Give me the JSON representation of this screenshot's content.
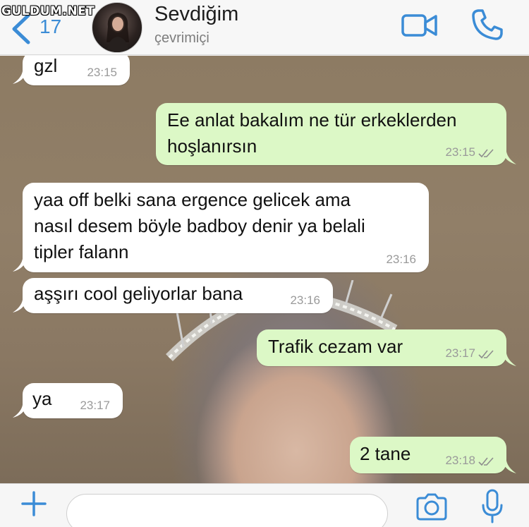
{
  "watermark": "GULDUM.NET",
  "header": {
    "back_count": "17",
    "contact_name": "Sevdiğim",
    "status": "çevrimiçi",
    "icons": {
      "back": "chevron-left-icon",
      "video": "video-camera-icon",
      "call": "phone-icon"
    },
    "accent": "#3b8cd6"
  },
  "messages": [
    {
      "dir": "in",
      "text": "gzl",
      "time": "23:15"
    },
    {
      "dir": "out",
      "text": "Ee anlat bakalım ne tür erkeklerden\nhoşlanırsın",
      "time": "23:15",
      "read": true
    },
    {
      "dir": "in",
      "text": "yaa off belki sana ergence gelicek ama\nnasıl desem böyle badboy denir ya belali\ntipler falann",
      "time": "23:16"
    },
    {
      "dir": "in",
      "text": "aşşırı cool geliyorlar bana",
      "time": "23:16"
    },
    {
      "dir": "out",
      "text": "Trafik cezam var",
      "time": "23:17",
      "read": true
    },
    {
      "dir": "in",
      "text": "ya",
      "time": "23:17"
    },
    {
      "dir": "out",
      "text": "2 tane",
      "time": "23:18",
      "read": true
    }
  ],
  "colors": {
    "incoming": "#ffffff",
    "outgoing": "#dcf8c6"
  },
  "input_bar": {
    "placeholder": "",
    "icons": {
      "plus": "plus-icon",
      "camera": "camera-icon",
      "mic": "microphone-icon"
    }
  }
}
